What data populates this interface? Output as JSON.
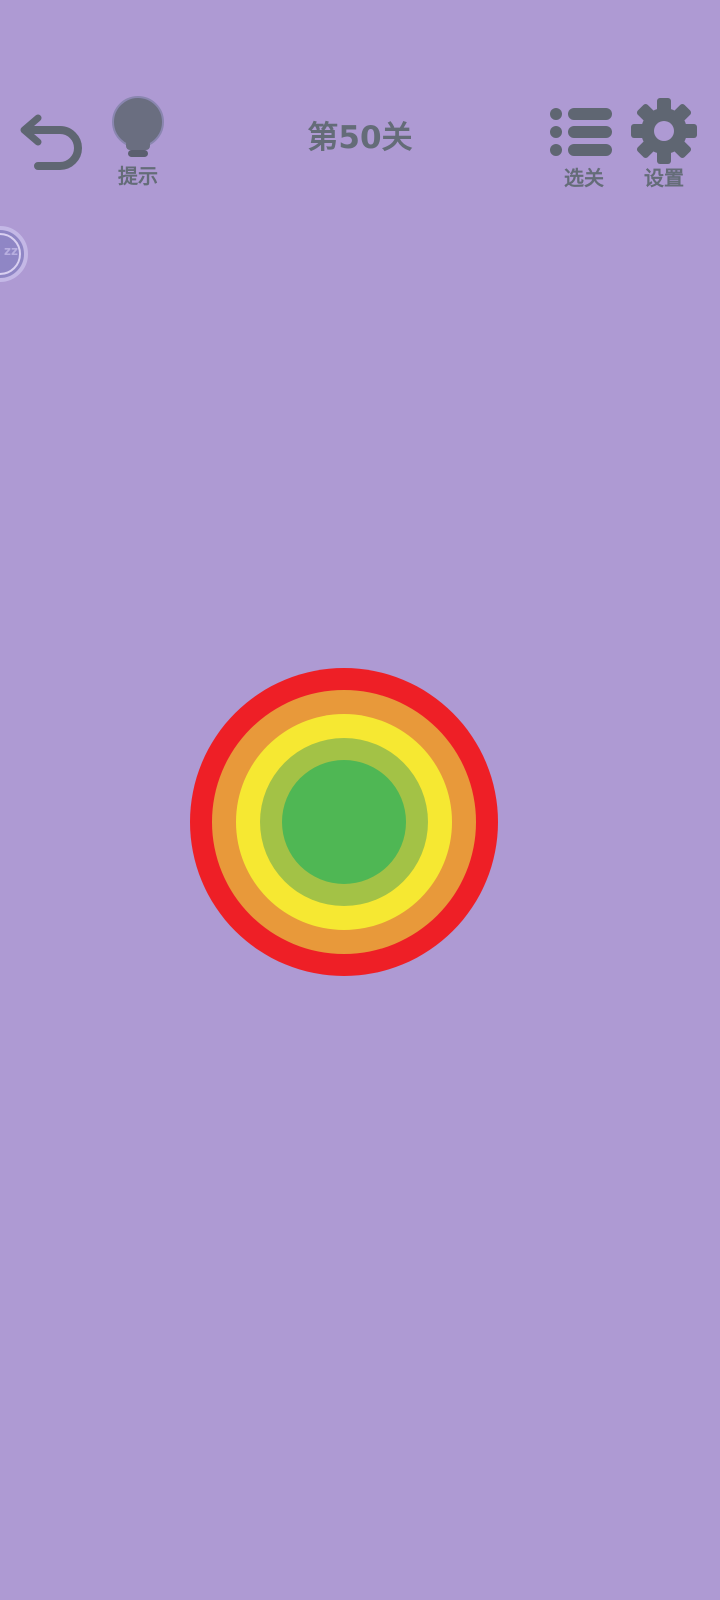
{
  "toolbar": {
    "hint_label": "提示",
    "level_title": "第50关",
    "levels_label": "选关",
    "settings_label": "设置",
    "icons": {
      "undo": "undo-icon",
      "hint": "lightbulb-icon",
      "levels": "list-icon",
      "settings": "gear-icon"
    },
    "icon_color": "#646c78"
  },
  "sleep_bubble": {
    "text": "zz"
  },
  "rings": {
    "colors_outer_to_inner": [
      "#ee1f26",
      "#e8993a",
      "#f6e832",
      "#a3c246",
      "#4fb754"
    ]
  },
  "theme": {
    "background": "#ae9ad3"
  }
}
